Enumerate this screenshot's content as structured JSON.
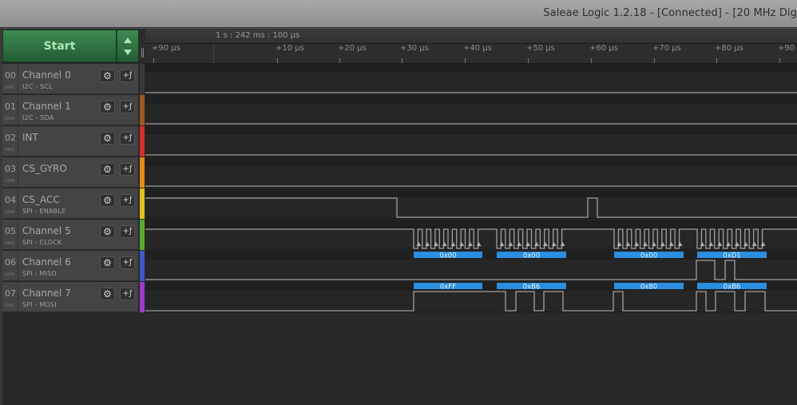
{
  "window": {
    "title": "Saleae Logic 1.2.18 - [Connected] - [20 MHz Dig"
  },
  "controls": {
    "start_label": "Start"
  },
  "ruler": {
    "absolute_time": "1 s : 242 ms : 100 μs",
    "ticks": [
      "+90 μs",
      "+10 μs",
      "+20 μs",
      "+30 μs",
      "+40 μs",
      "+50 μs",
      "+60 μs",
      "+70 μs",
      "+80 μs",
      "+90"
    ]
  },
  "channels": [
    {
      "num": "00",
      "name": "Channel 0",
      "sub": "I2C - SCL",
      "color": "#3a3a3a"
    },
    {
      "num": "01",
      "name": "Channel 1",
      "sub": "I2C - SDA",
      "color": "#9a5a22"
    },
    {
      "num": "02",
      "name": "INT",
      "sub": "",
      "color": "#d6302a"
    },
    {
      "num": "03",
      "name": "CS_GYRO",
      "sub": "",
      "color": "#e48a1a"
    },
    {
      "num": "04",
      "name": "CS_ACC",
      "sub": "SPI - ENABLE",
      "color": "#e2c21e"
    },
    {
      "num": "05",
      "name": "Channel 5",
      "sub": "SPI - CLOCK",
      "color": "#5aa830"
    },
    {
      "num": "06",
      "name": "Channel 6",
      "sub": "SPI - MISO",
      "color": "#4158c8"
    },
    {
      "num": "07",
      "name": "Channel 7",
      "sub": "SPI - MOSI",
      "color": "#9a3cc8"
    }
  ],
  "icons": {
    "gear": "⚙",
    "trigger": "+ƒ"
  },
  "decoded": {
    "miso": [
      "0x00",
      "0x00",
      "0x00",
      "0xD1"
    ],
    "mosi": [
      "0xFF",
      "0xB6",
      "0x80",
      "0xB6"
    ]
  },
  "colors": {
    "accent": "#2b8ee0",
    "start_green": "#2f7a45",
    "signal": "#9a9a9a"
  }
}
